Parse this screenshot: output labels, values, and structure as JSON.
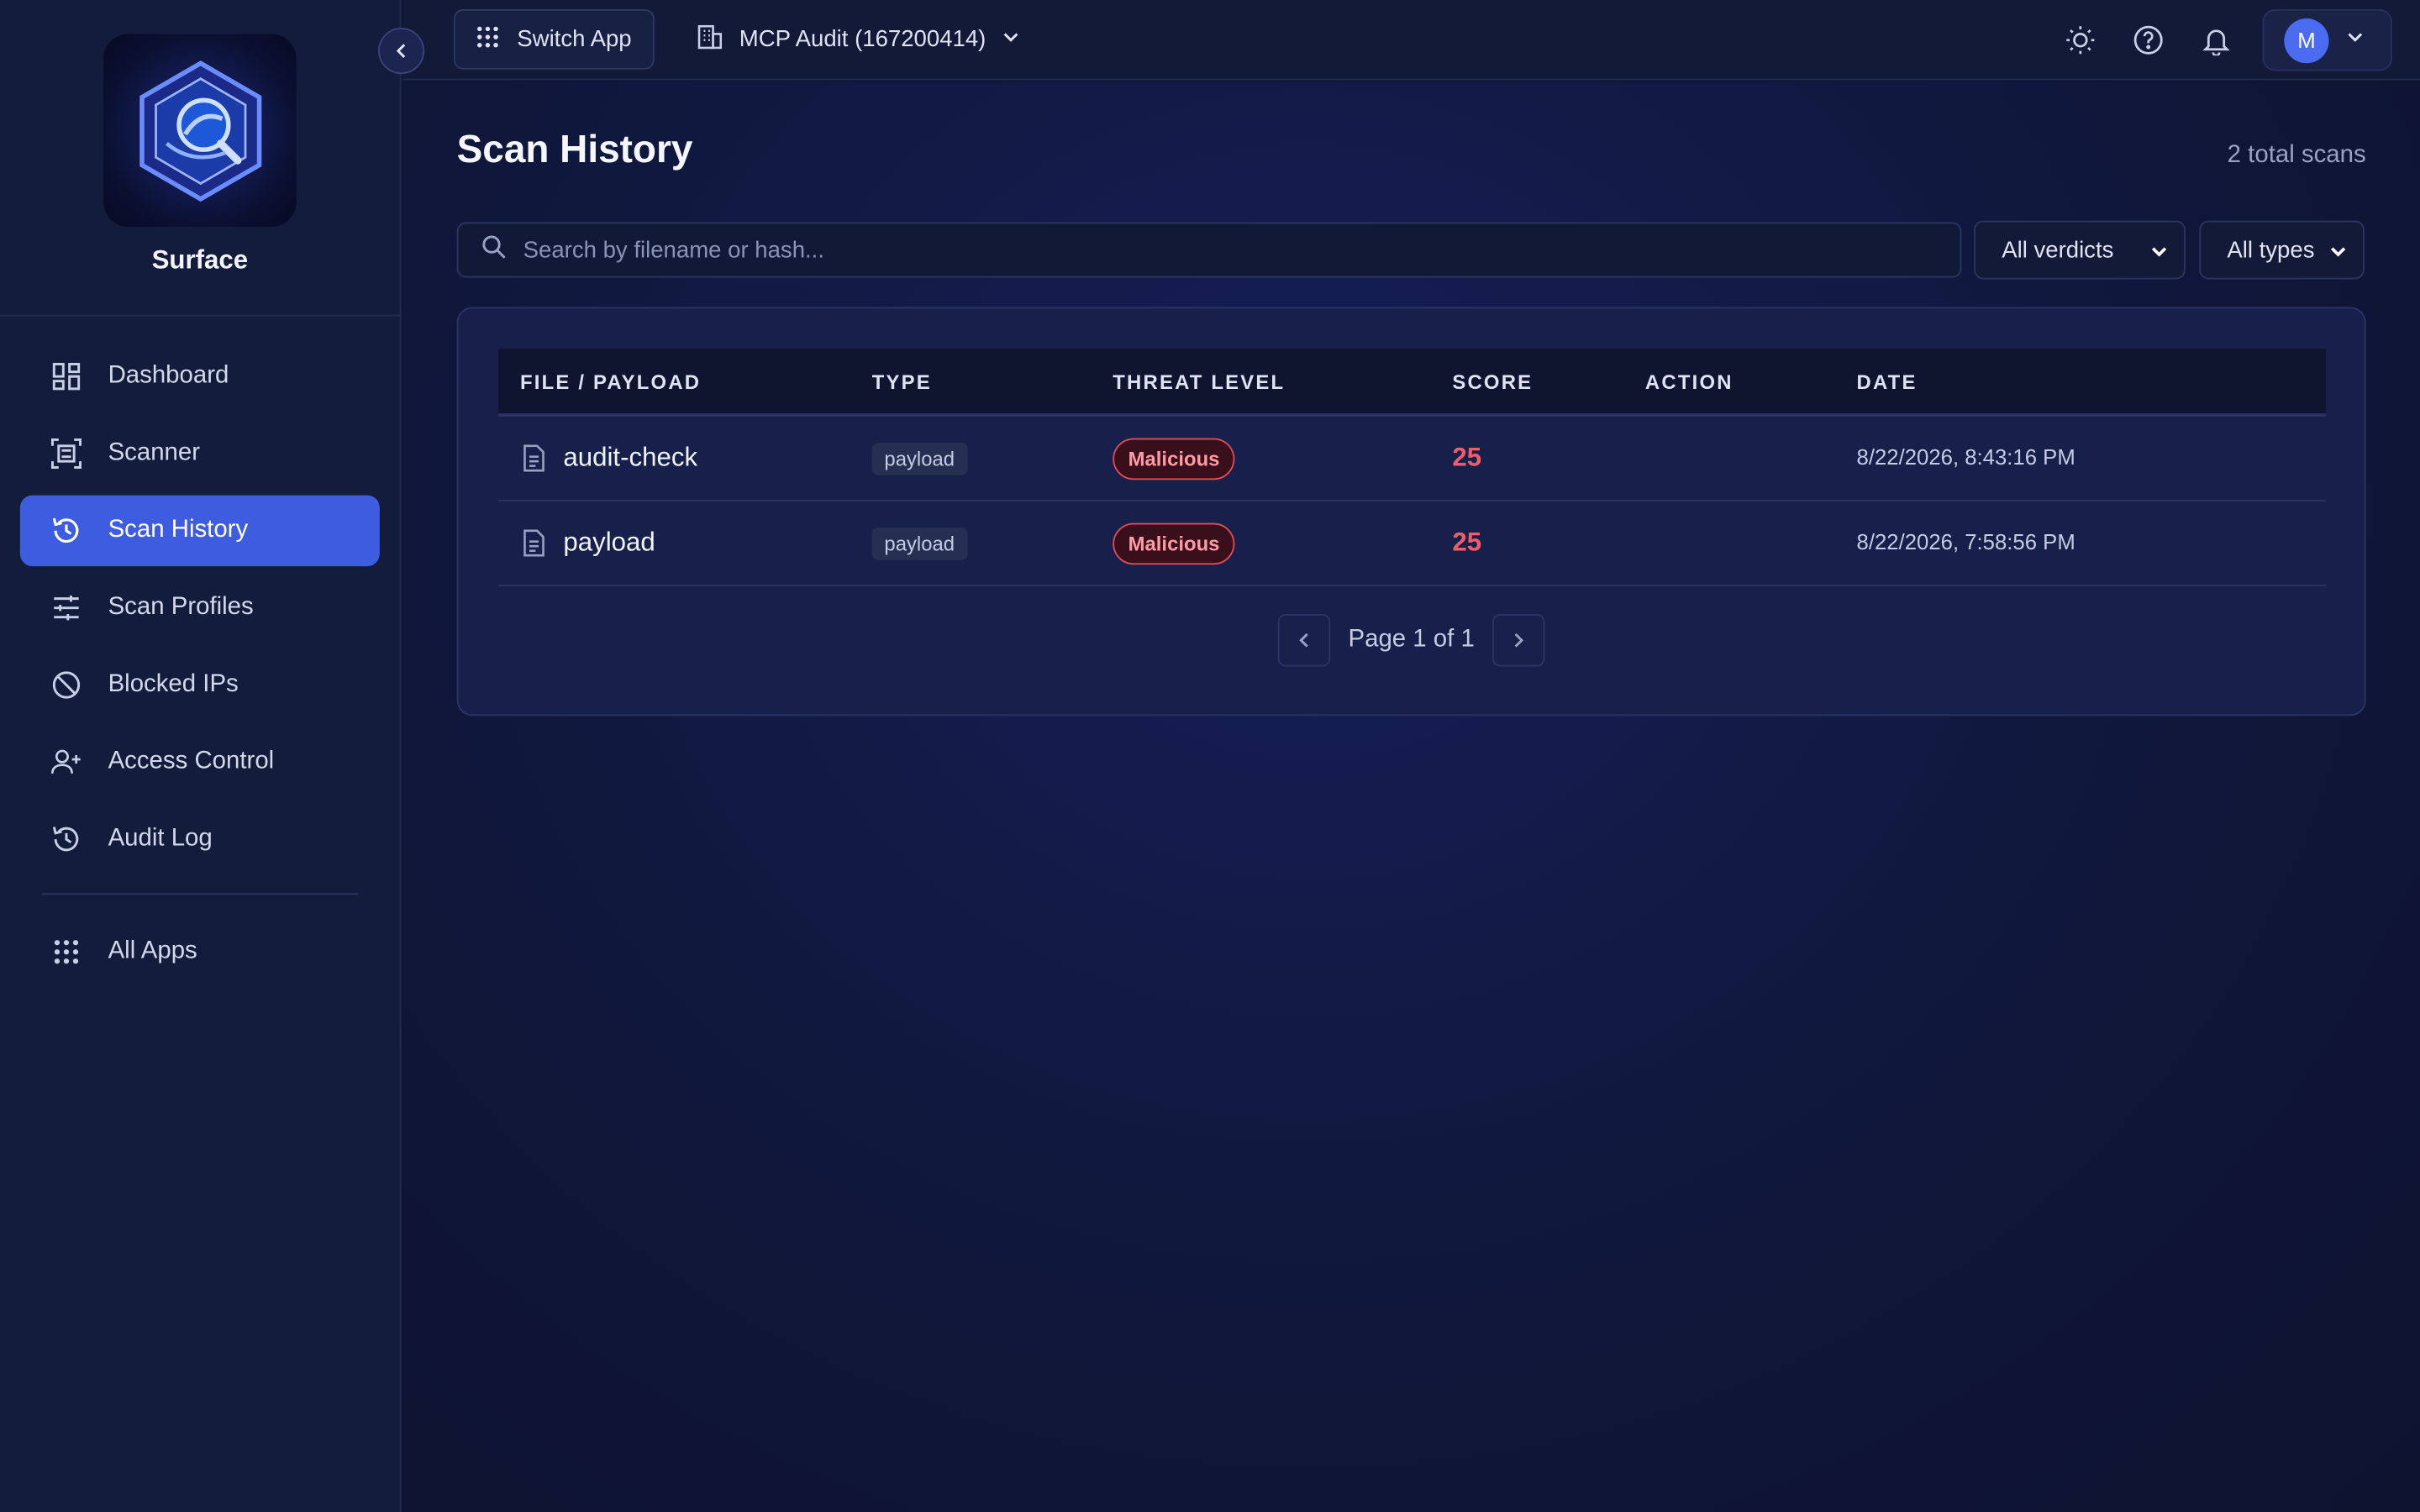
{
  "brand": {
    "name": "Surface"
  },
  "sidebar": {
    "items": [
      {
        "label": "Dashboard",
        "icon": "dashboard-icon"
      },
      {
        "label": "Scanner",
        "icon": "scanner-icon"
      },
      {
        "label": "Scan History",
        "icon": "history-icon",
        "active": true
      },
      {
        "label": "Scan Profiles",
        "icon": "sliders-icon"
      },
      {
        "label": "Blocked IPs",
        "icon": "block-icon"
      },
      {
        "label": "Access Control",
        "icon": "users-icon"
      },
      {
        "label": "Audit Log",
        "icon": "history-icon"
      }
    ],
    "footer_item": {
      "label": "All Apps",
      "icon": "grid-icon"
    }
  },
  "topbar": {
    "switch_app_label": "Switch App",
    "org_label": "MCP Audit (167200414)",
    "avatar_initial": "M"
  },
  "page": {
    "title": "Scan History",
    "total": "2 total scans"
  },
  "filters": {
    "search_placeholder": "Search by filename or hash...",
    "verdict_value": "All verdicts",
    "type_value": "All types"
  },
  "table": {
    "headers": [
      "FILE / PAYLOAD",
      "TYPE",
      "THREAT LEVEL",
      "SCORE",
      "ACTION",
      "DATE"
    ],
    "rows": [
      {
        "name": "audit-check",
        "type": "payload",
        "threat": "Malicious",
        "score": "25",
        "action": "",
        "date": "8/22/2026, 8:43:16 PM"
      },
      {
        "name": "payload",
        "type": "payload",
        "threat": "Malicious",
        "score": "25",
        "action": "",
        "date": "8/22/2026, 7:58:56 PM"
      }
    ]
  },
  "pagination": {
    "text": "Page 1 of 1"
  },
  "colors": {
    "accent": "#3d5ce0",
    "malicious": "#f25c6a",
    "background": "#0f1530"
  }
}
